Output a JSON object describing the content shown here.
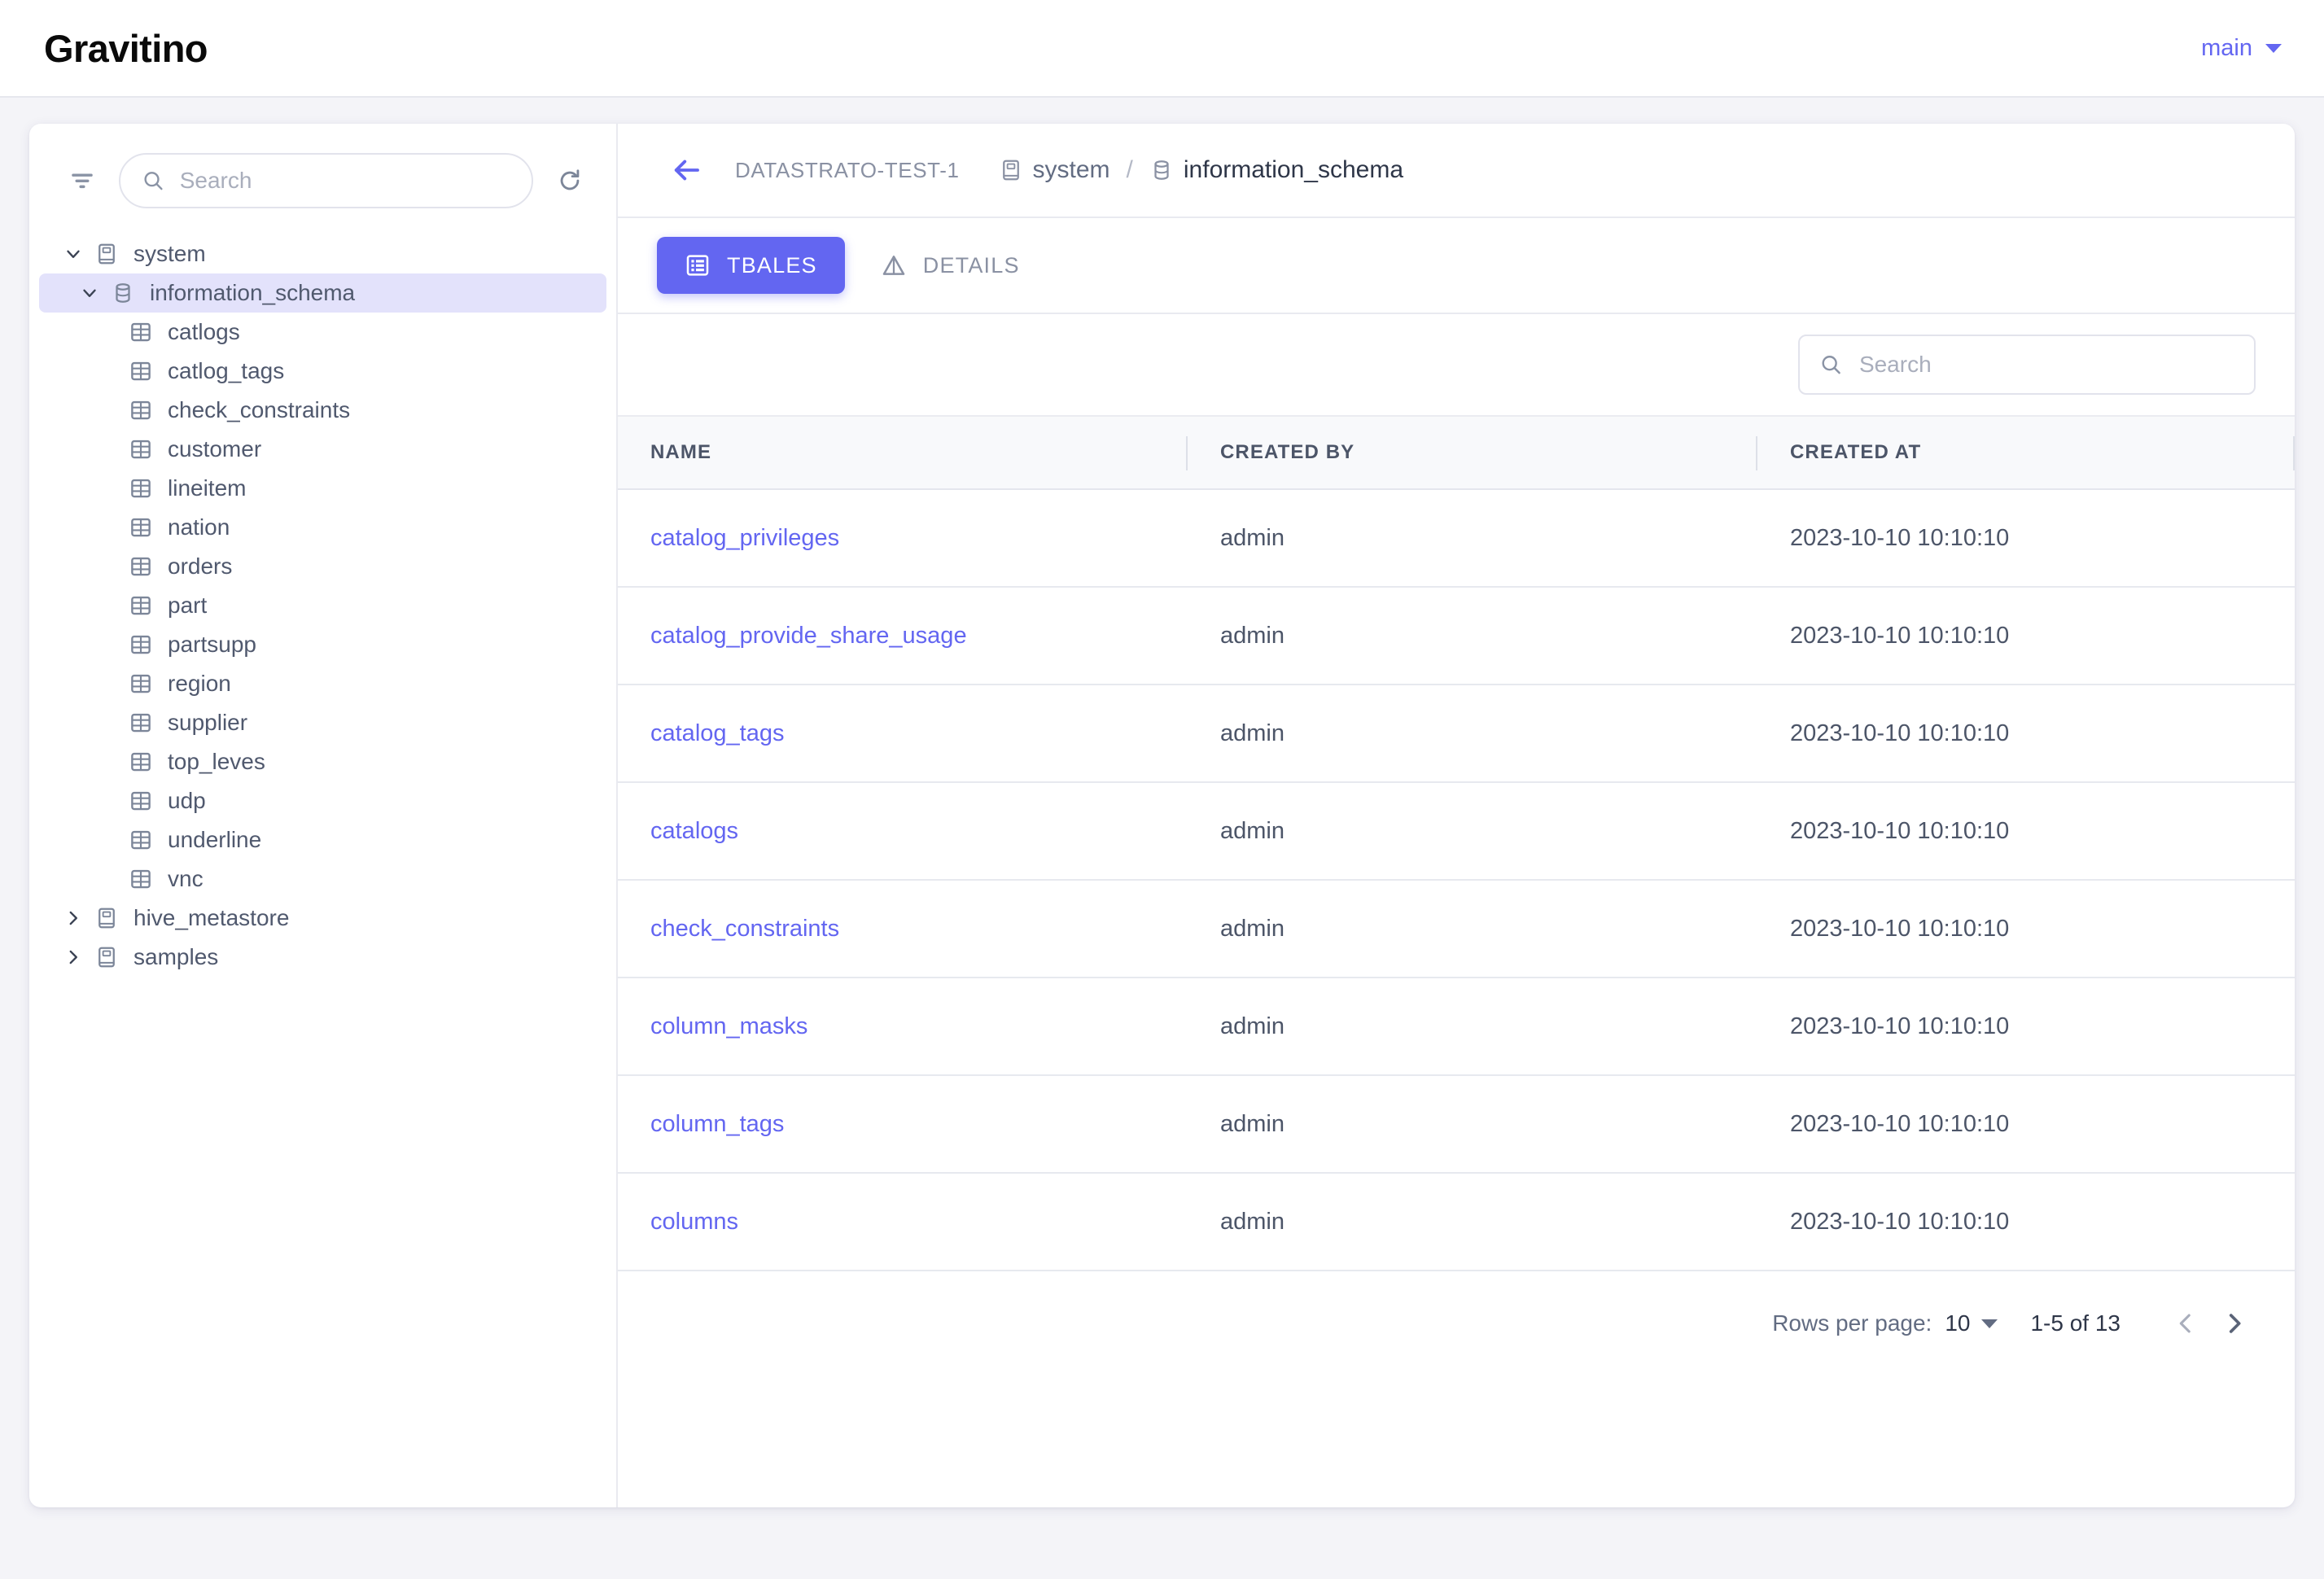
{
  "header": {
    "brand": "Gravitino",
    "branch": "main",
    "branch_icon": "chevron-down-icon"
  },
  "sidebar": {
    "search_placeholder": "Search",
    "search_value": "",
    "filter_icon": "filter-icon",
    "refresh_icon": "refresh-icon",
    "tree": [
      {
        "label": "system",
        "depth": 0,
        "icon": "catalog-icon",
        "chevron": "chevron-down",
        "selected": false
      },
      {
        "label": "information_schema",
        "depth": 1,
        "icon": "schema-icon",
        "chevron": "chevron-down",
        "selected": true
      },
      {
        "label": "catlogs",
        "depth": 2,
        "icon": "table-icon",
        "chevron": "",
        "selected": false
      },
      {
        "label": "catlog_tags",
        "depth": 2,
        "icon": "table-icon",
        "chevron": "",
        "selected": false
      },
      {
        "label": "check_constraints",
        "depth": 2,
        "icon": "table-icon",
        "chevron": "",
        "selected": false
      },
      {
        "label": "customer",
        "depth": 2,
        "icon": "table-icon",
        "chevron": "",
        "selected": false
      },
      {
        "label": "lineitem",
        "depth": 2,
        "icon": "table-icon",
        "chevron": "",
        "selected": false
      },
      {
        "label": "nation",
        "depth": 2,
        "icon": "table-icon",
        "chevron": "",
        "selected": false
      },
      {
        "label": "orders",
        "depth": 2,
        "icon": "table-icon",
        "chevron": "",
        "selected": false
      },
      {
        "label": "part",
        "depth": 2,
        "icon": "table-icon",
        "chevron": "",
        "selected": false
      },
      {
        "label": "partsupp",
        "depth": 2,
        "icon": "table-icon",
        "chevron": "",
        "selected": false
      },
      {
        "label": "region",
        "depth": 2,
        "icon": "table-icon",
        "chevron": "",
        "selected": false
      },
      {
        "label": "supplier",
        "depth": 2,
        "icon": "table-icon",
        "chevron": "",
        "selected": false
      },
      {
        "label": "top_leves",
        "depth": 2,
        "icon": "table-icon",
        "chevron": "",
        "selected": false
      },
      {
        "label": "udp",
        "depth": 2,
        "icon": "table-icon",
        "chevron": "",
        "selected": false
      },
      {
        "label": "underline",
        "depth": 2,
        "icon": "table-icon",
        "chevron": "",
        "selected": false
      },
      {
        "label": "vnc",
        "depth": 2,
        "icon": "table-icon",
        "chevron": "",
        "selected": false
      },
      {
        "label": "hive_metastore",
        "depth": 0,
        "icon": "catalog-icon",
        "chevron": "chevron-right",
        "selected": false
      },
      {
        "label": "samples",
        "depth": 0,
        "icon": "catalog-icon",
        "chevron": "chevron-right",
        "selected": false
      }
    ]
  },
  "main": {
    "back_icon": "arrow-left-icon",
    "breadcrumb": {
      "root": "DATASTRATO-TEST-1",
      "catalog": "system",
      "separator": "/",
      "schema": "information_schema"
    },
    "tabs": [
      {
        "label": "TBALES",
        "icon": "list-icon",
        "active": true
      },
      {
        "label": "DETAILS",
        "icon": "triangle-icon",
        "active": false
      }
    ],
    "table_search_placeholder": "Search",
    "table_search_value": "",
    "columns": [
      "NAME",
      "CREATED BY",
      "CREATED AT"
    ],
    "rows": [
      {
        "name": "catalog_privileges",
        "created_by": "admin",
        "created_at": "2023-10-10 10:10:10"
      },
      {
        "name": "catalog_provide_share_usage",
        "created_by": "admin",
        "created_at": "2023-10-10 10:10:10"
      },
      {
        "name": "catalog_tags",
        "created_by": "admin",
        "created_at": "2023-10-10 10:10:10"
      },
      {
        "name": "catalogs",
        "created_by": "admin",
        "created_at": "2023-10-10 10:10:10"
      },
      {
        "name": "check_constraints",
        "created_by": "admin",
        "created_at": "2023-10-10 10:10:10"
      },
      {
        "name": "column_masks",
        "created_by": "admin",
        "created_at": "2023-10-10 10:10:10"
      },
      {
        "name": "column_tags",
        "created_by": "admin",
        "created_at": "2023-10-10 10:10:10"
      },
      {
        "name": "columns",
        "created_by": "admin",
        "created_at": "2023-10-10 10:10:10"
      }
    ],
    "pagination": {
      "rows_per_page_label": "Rows per page:",
      "rows_per_page_value": "10",
      "range": "1-5 of 13",
      "prev_icon": "chevron-left-icon",
      "next_icon": "chevron-right-icon"
    }
  },
  "colors": {
    "accent": "#6366F1",
    "selected_row_bg": "#E3E2FB",
    "page_bg": "#F4F4F8",
    "text_primary": "#2E3648",
    "text_muted": "#8A91A3"
  }
}
